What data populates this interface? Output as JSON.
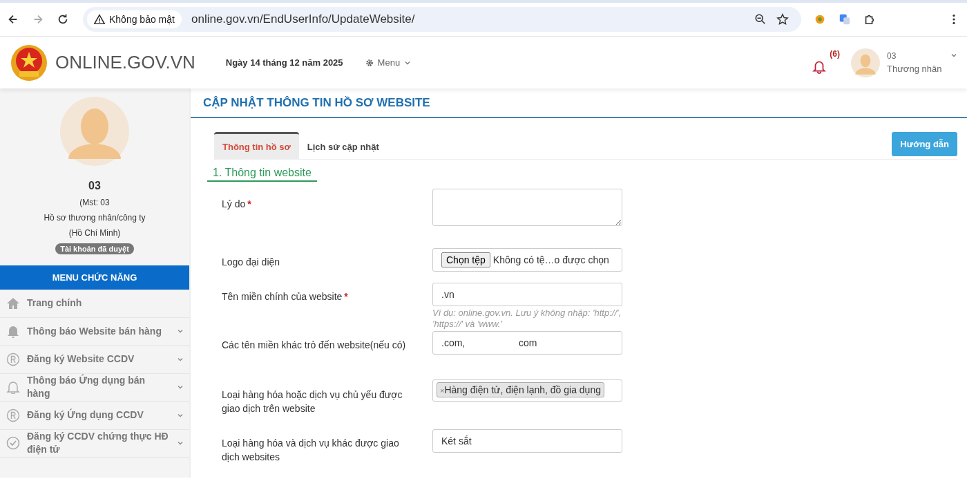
{
  "browser": {
    "security": "Không bảo mật",
    "url": "online.gov.vn/EndUserInfo/UpdateWebsite/"
  },
  "header": {
    "logo_text": "ONLINE.GOV.VN",
    "date": "Ngày 14 tháng 12 năm 2025",
    "menu": "Menu",
    "notification_count": "(6)",
    "user_id": "03",
    "user_role": "Thương nhân"
  },
  "profile": {
    "name": "03",
    "tax_id": "(Mst: 03",
    "type": "Hồ sơ thương nhân/công ty",
    "city": "(Hồ Chí Minh)",
    "status": "Tài khoản đã duyệt"
  },
  "sidebar": {
    "title": "MENU CHỨC NĂNG",
    "items": [
      {
        "label": "Trang chính",
        "kind": "home",
        "expandable": false
      },
      {
        "label": "Thông báo Website bán hàng",
        "kind": "bell",
        "expandable": true
      },
      {
        "label": "Đăng ký Website CCDV",
        "kind": "registered",
        "expandable": true
      },
      {
        "label": "Thông báo Ứng dụng bán hàng",
        "kind": "bell-outline",
        "expandable": true
      },
      {
        "label": "Đăng ký Ứng dụng CCDV",
        "kind": "registered",
        "expandable": true
      },
      {
        "label": "Đăng ký CCDV chứng thực HĐ điện tử",
        "kind": "check",
        "expandable": true
      }
    ]
  },
  "page_title": "CẬP NHẬT THÔNG TIN HỒ SƠ WEBSITE",
  "tabs": [
    {
      "label": "Thông tin hồ sơ",
      "selected": true
    },
    {
      "label": "Lịch sử cập nhật",
      "selected": false
    }
  ],
  "help_button": "Hướng dẫn",
  "section_title": "1. Thông tin website",
  "fields": [
    {
      "label": "Lý do",
      "required_mark": "*",
      "kind": "textarea"
    },
    {
      "label": "Logo đại diện",
      "kind": "file",
      "button": "Chọn tệp",
      "value": "Không có tệ…o được chọn"
    },
    {
      "label": "Tên miền chính của website",
      "required_mark": "*",
      "kind": "text",
      "value": ".vn",
      "hint": "Ví dụ: online.gov.vn. Lưu ý không nhập: 'http://', 'https://' và 'www.'"
    },
    {
      "label": "Các tên miền khác trỏ đến website(nếu có)",
      "kind": "text",
      "value": ".com,                    com"
    },
    {
      "label": "Loại hàng hóa hoặc dịch vụ chủ yếu được giao dịch trên website",
      "kind": "tags",
      "tags": [
        {
          "remove": "×",
          "label": "Hàng điện tử, điện lạnh, đồ gia dụng"
        }
      ]
    },
    {
      "label": "Loại hàng hóa và dịch vụ khác được giao dịch websites",
      "kind": "text",
      "value": "Két sắt"
    }
  ]
}
